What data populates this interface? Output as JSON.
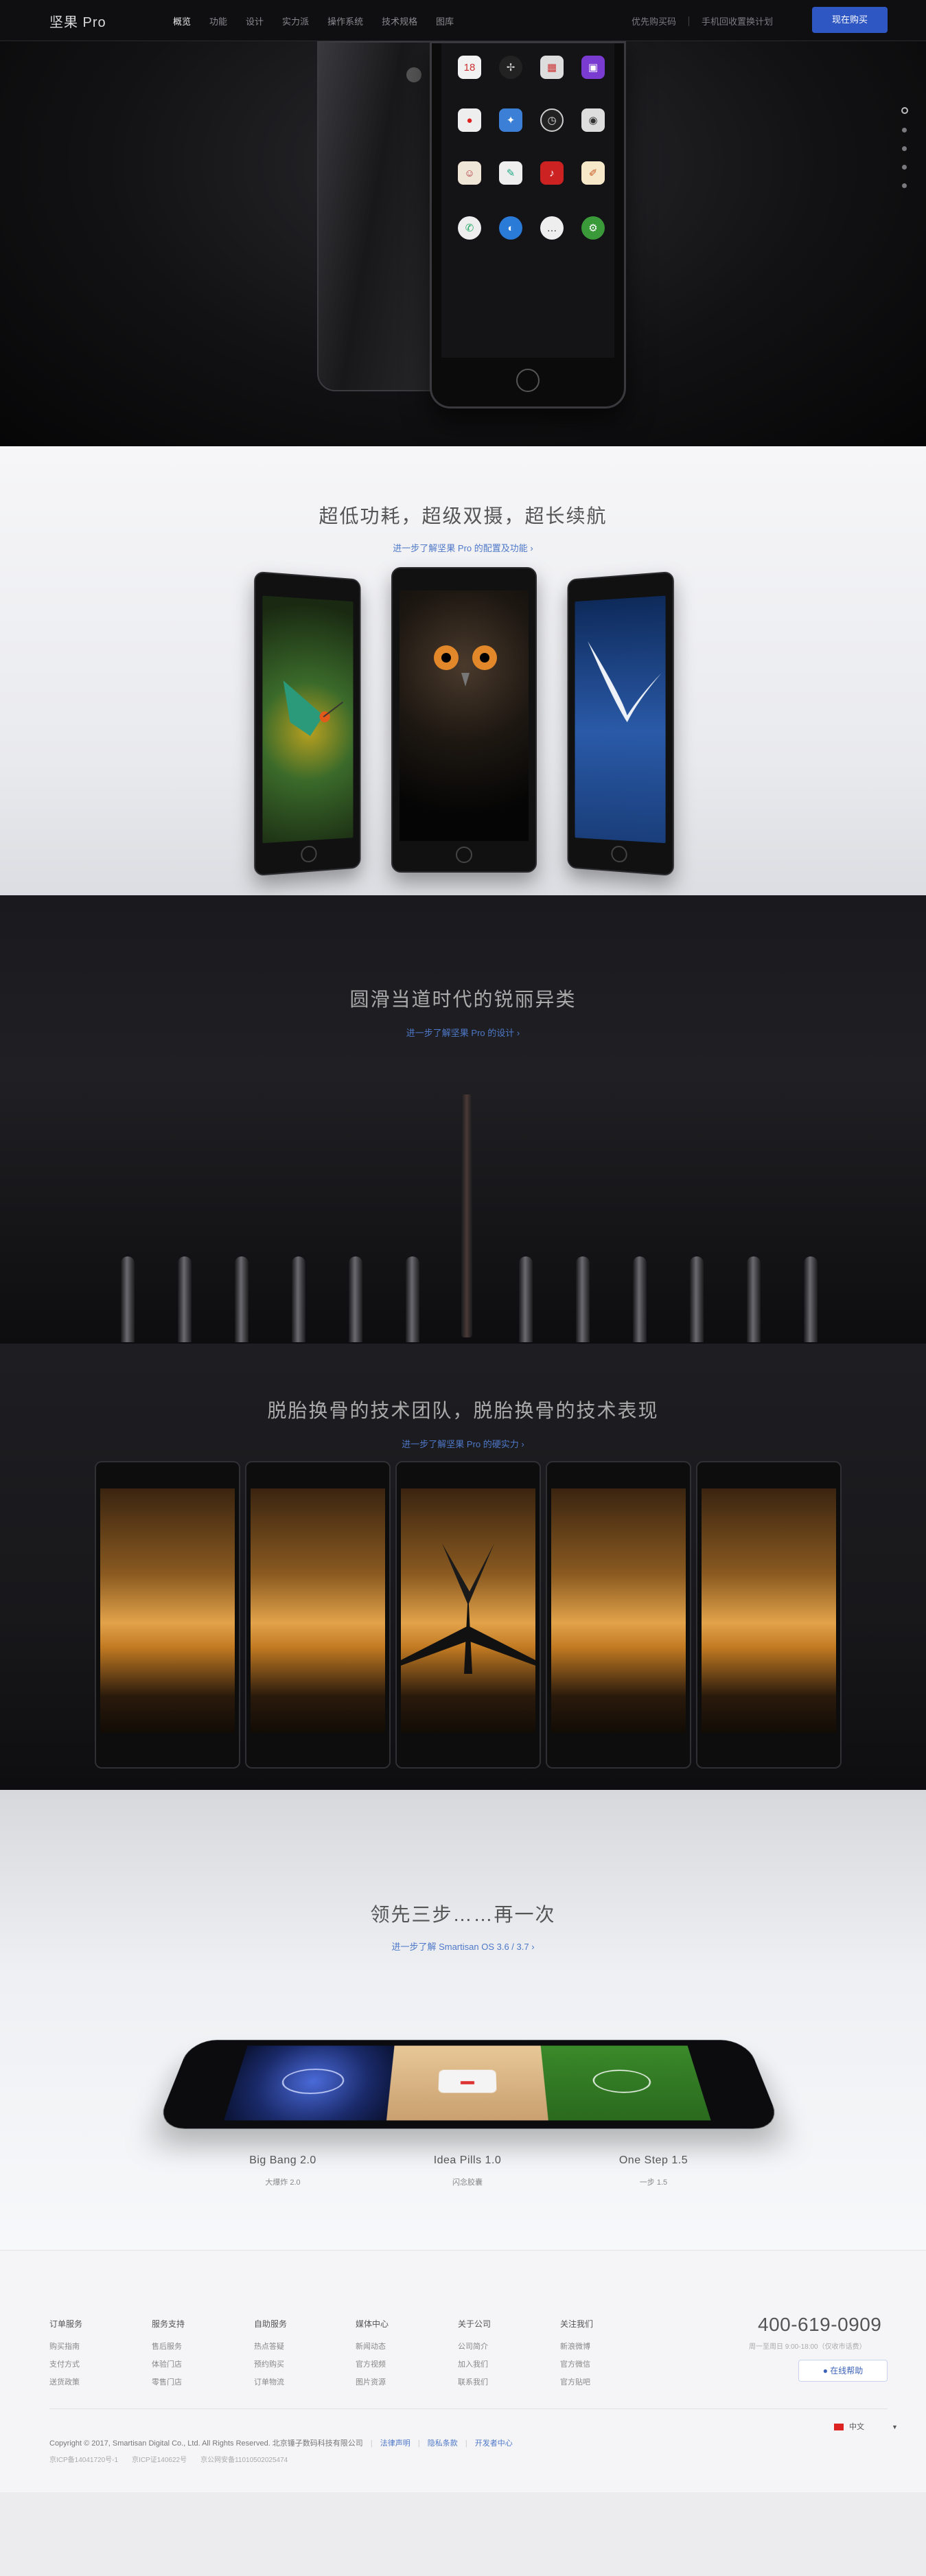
{
  "header": {
    "brand": "坚果 Pro",
    "nav": [
      "概览",
      "功能",
      "设计",
      "实力派",
      "操作系统",
      "技术规格",
      "图库"
    ],
    "links": [
      "优先购买码",
      "手机回收置换计划"
    ],
    "buy": "现在购买"
  },
  "sections": {
    "s2": {
      "title": "超低功耗，超级双摄，超长续航",
      "link": "进一步了解坚果 Pro 的配置及功能 ›"
    },
    "s3": {
      "title": "圆滑当道时代的锐丽异类",
      "link": "进一步了解坚果 Pro 的设计 ›"
    },
    "s4": {
      "title": "脱胎换骨的技术团队，脱胎换骨的技术表现",
      "link": "进一步了解坚果 Pro 的硬实力 ›"
    },
    "s5": {
      "title": "领先三步……再一次",
      "link": "进一步了解 Smartisan OS 3.6 / 3.7 ›"
    }
  },
  "features": [
    {
      "name": "Big Bang 2.0",
      "sub": "大爆炸 2.0"
    },
    {
      "name": "Idea Pills 1.0",
      "sub": "闪念胶囊"
    },
    {
      "name": "One Step 1.5",
      "sub": "一步 1.5"
    }
  ],
  "footer": {
    "columns": [
      {
        "title": "订单服务",
        "items": [
          "购买指南",
          "支付方式",
          "送货政策"
        ]
      },
      {
        "title": "服务支持",
        "items": [
          "售后服务",
          "体验门店",
          "零售门店"
        ]
      },
      {
        "title": "自助服务",
        "items": [
          "热点答疑",
          "预约购买",
          "订单物流"
        ]
      },
      {
        "title": "媒体中心",
        "items": [
          "新闻动态",
          "官方视频",
          "图片资源"
        ]
      },
      {
        "title": "关于公司",
        "items": [
          "公司简介",
          "加入我们",
          "联系我们"
        ]
      },
      {
        "title": "关注我们",
        "items": [
          "新浪微博",
          "官方微信",
          "官方贴吧"
        ]
      }
    ],
    "phone": "400-619-0909",
    "phone_sub": "周一至周日 9:00-18:00（仅收市话费）",
    "help": "在线帮助",
    "lang": "中文",
    "copyright": "Copyright © 2017, Smartisan Digital Co., Ltd. All Rights Reserved. 北京锤子数码科技有限公司",
    "links": [
      "法律声明",
      "隐私条款",
      "开发者中心"
    ],
    "icp": "京ICP备14041720号-1　　京ICP证140622号　　京公网安备11010502025474"
  },
  "colors": {
    "accent": "#2f57c4",
    "link": "#4e78c8"
  }
}
